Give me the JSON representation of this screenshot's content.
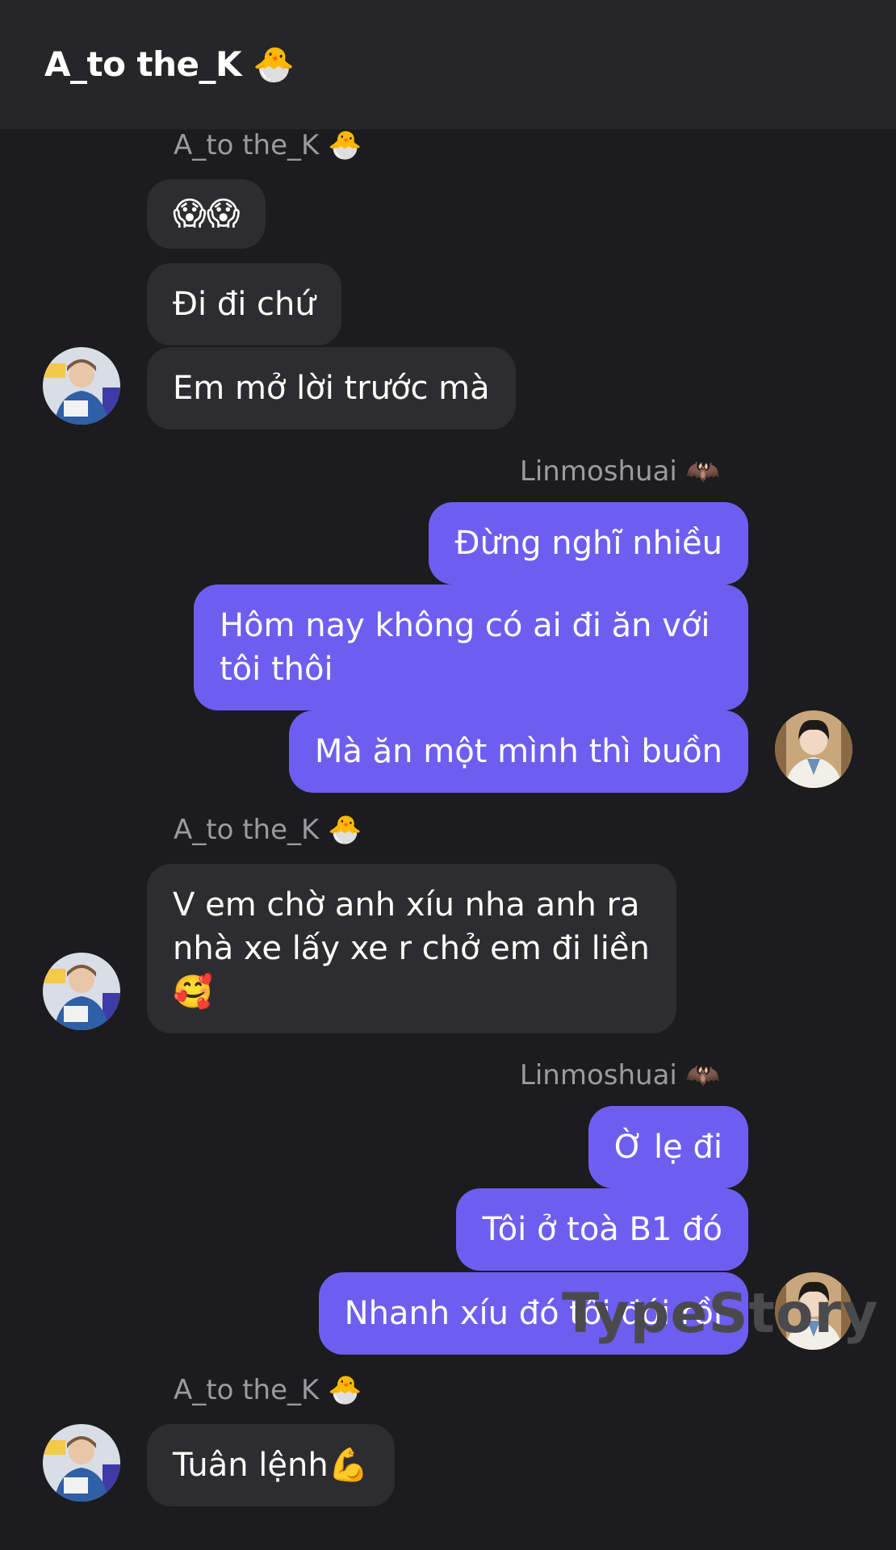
{
  "header": {
    "title": "A_to the_K 🐣"
  },
  "messages": {
    "g1_sender": "A_to the_K 🐣",
    "g1_m1": "😱😱",
    "g1_m2": "Đi đi chứ",
    "g1_m3": "Em mở lời trước mà",
    "g2_sender": "Linmoshuai 🦇",
    "g2_m1": "Đừng nghĩ nhiều",
    "g2_m2": "Hôm nay không có ai đi ăn với tôi thôi",
    "g2_m3": "Mà ăn một mình thì buồn",
    "g3_sender": "A_to the_K 🐣",
    "g3_m1": "V em chờ anh xíu nha anh ra nhà xe lấy xe r chở em đi liền🥰",
    "g4_sender": "Linmoshuai 🦇",
    "g4_m1": "Ờ lẹ đi",
    "g4_m2": "Tôi ở toà B1 đó",
    "g4_m3": "Nhanh xíu đó tôi đói rồi",
    "g5_sender": "A_to the_K 🐣",
    "g5_m1": "Tuân lệnh💪"
  },
  "watermark": "TypeStory",
  "colors": {
    "background": "#1c1c1e",
    "header": "#262628",
    "incoming_bubble": "#2d2d30",
    "outgoing_bubble": "#6e5ef0",
    "sender_name": "#9a9aa0"
  }
}
